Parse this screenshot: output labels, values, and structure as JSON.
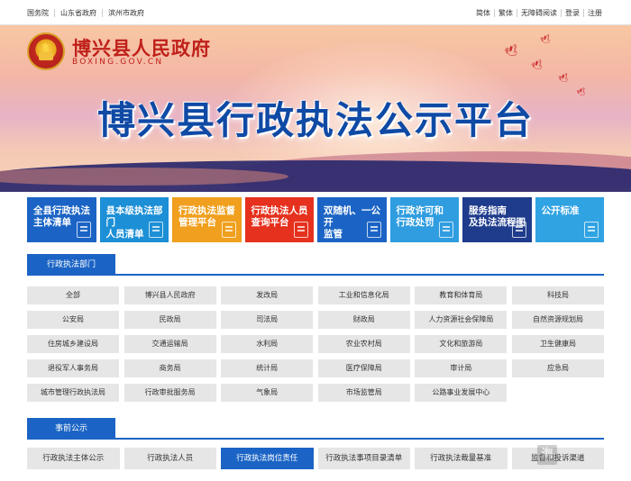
{
  "topbar": {
    "left_links": [
      "国务院",
      "山东省政府",
      "滨州市政府"
    ],
    "right_links": [
      "简体",
      "繁体",
      "无障碍阅读",
      "登录",
      "注册"
    ]
  },
  "header": {
    "site_name": "博兴县人民政府",
    "site_domain": "BOXING.GOV.CN",
    "banner_title": "博兴县行政执法公示平台"
  },
  "tiles": [
    {
      "label": "全县行政执法\n主体清单",
      "color": "#1b64c5"
    },
    {
      "label": "县本级执法部门\n人员清单",
      "color": "#1c8fd6"
    },
    {
      "label": "行政执法监督\n管理平台",
      "color": "#f0a01e"
    },
    {
      "label": "行政执法人员\n查询平台",
      "color": "#e5311d"
    },
    {
      "label": "双随机、一公开\n监管",
      "color": "#1b64c5"
    },
    {
      "label": "行政许可和\n行政处罚",
      "color": "#2f9de0"
    },
    {
      "label": "服务指南\n及执法流程图",
      "color": "#1f3c8c"
    },
    {
      "label": "公开标准",
      "color": "#30a3e3"
    }
  ],
  "dept_section": {
    "title": "行政执法部门",
    "items": [
      "全部",
      "博兴县人民政府",
      "发改局",
      "工业和信息化局",
      "教育和体育局",
      "科技局",
      "公安局",
      "民政局",
      "司法局",
      "财政局",
      "人力资源社会保障局",
      "自然资源规划局",
      "住房城乡建设局",
      "交通运输局",
      "水利局",
      "农业农村局",
      "文化和旅游局",
      "卫生健康局",
      "退役军人事务局",
      "商务局",
      "统计局",
      "医疗保障局",
      "审计局",
      "应急局",
      "城市管理行政执法局",
      "行政审批服务局",
      "气象局",
      "市场监管局",
      "公路事业发展中心"
    ]
  },
  "public_section": {
    "title": "事前公示",
    "tabs": [
      "行政执法主体公示",
      "行政执法人员",
      "行政执法岗位责任",
      "行政执法事项目录清单",
      "行政执法裁量基准",
      "监督和投诉渠道"
    ],
    "active_index": 2
  },
  "watermark": {
    "text": "海"
  }
}
